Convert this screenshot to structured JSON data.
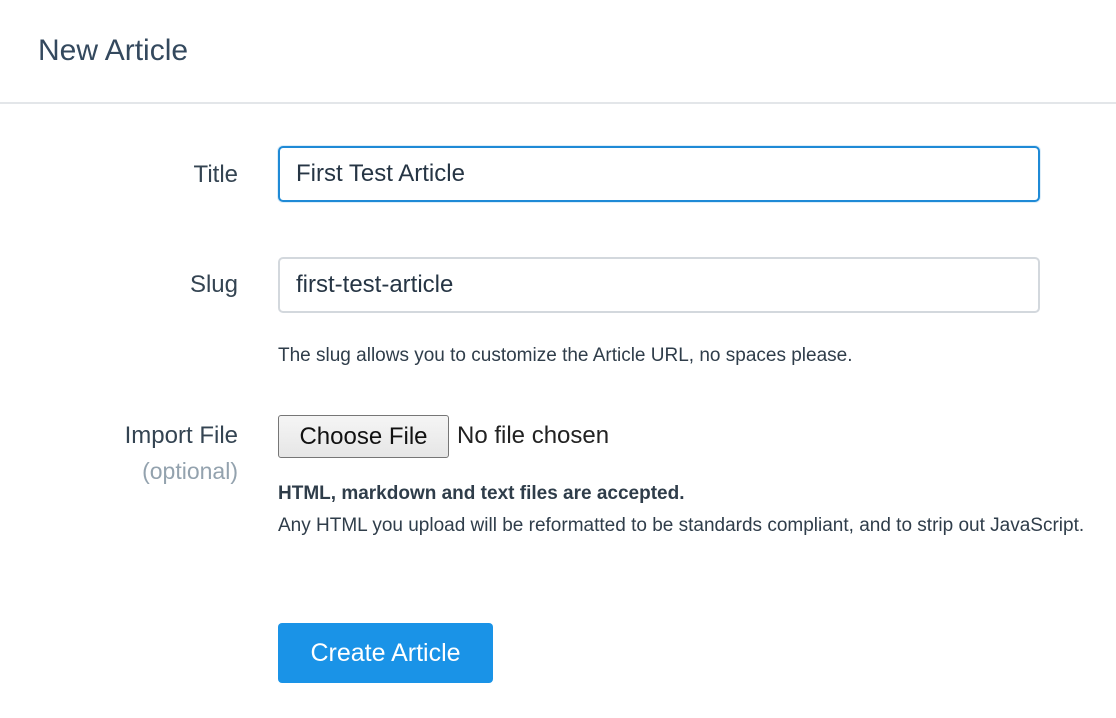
{
  "header": {
    "title": "New Article"
  },
  "form": {
    "title_field": {
      "label": "Title",
      "value": "First Test Article"
    },
    "slug_field": {
      "label": "Slug",
      "value": "first-test-article",
      "hint": "The slug allows you to customize the Article URL, no spaces please."
    },
    "import_file": {
      "label": "Import File",
      "optional_label": "(optional)",
      "button_label": "Choose File",
      "status": "No file chosen",
      "note_strong": "HTML, markdown and text files are accepted.",
      "note_body": "Any HTML you upload will be reformatted to be standards compliant, and to strip out JavaScript."
    },
    "submit_label": "Create Article"
  },
  "colors": {
    "primary_button": "#1a93e7",
    "focus_border": "#1f8ad6",
    "optional_text": "#93a2ae"
  }
}
